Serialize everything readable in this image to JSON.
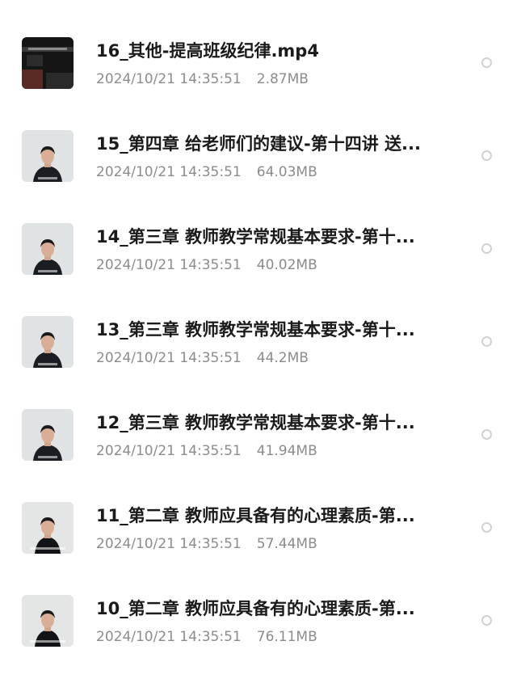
{
  "files": [
    {
      "name": "16_其他-提高班级纪律.mp4",
      "date": "2024/10/21 14:35:51",
      "size": "2.87MB",
      "thumb": "dark-video-thumbnail"
    },
    {
      "name": "15_第四章 给老师们的建议-第十四讲 送...",
      "date": "2024/10/21 14:35:51",
      "size": "64.03MB",
      "thumb": "lecturer-video-thumbnail"
    },
    {
      "name": "14_第三章 教师教学常规基本要求-第十...",
      "date": "2024/10/21 14:35:51",
      "size": "40.02MB",
      "thumb": "lecturer-video-thumbnail"
    },
    {
      "name": "13_第三章 教师教学常规基本要求-第十...",
      "date": "2024/10/21 14:35:51",
      "size": "44.2MB",
      "thumb": "lecturer-video-thumbnail"
    },
    {
      "name": "12_第三章 教师教学常规基本要求-第十...",
      "date": "2024/10/21 14:35:51",
      "size": "41.94MB",
      "thumb": "lecturer-video-thumbnail"
    },
    {
      "name": "11_第二章 教师应具备有的心理素质-第...",
      "date": "2024/10/21 14:35:51",
      "size": "57.44MB",
      "thumb": "lecturer-video-thumbnail"
    },
    {
      "name": "10_第二章 教师应具备有的心理素质-第...",
      "date": "2024/10/21 14:35:51",
      "size": "76.11MB",
      "thumb": "lecturer-video-thumbnail"
    }
  ]
}
